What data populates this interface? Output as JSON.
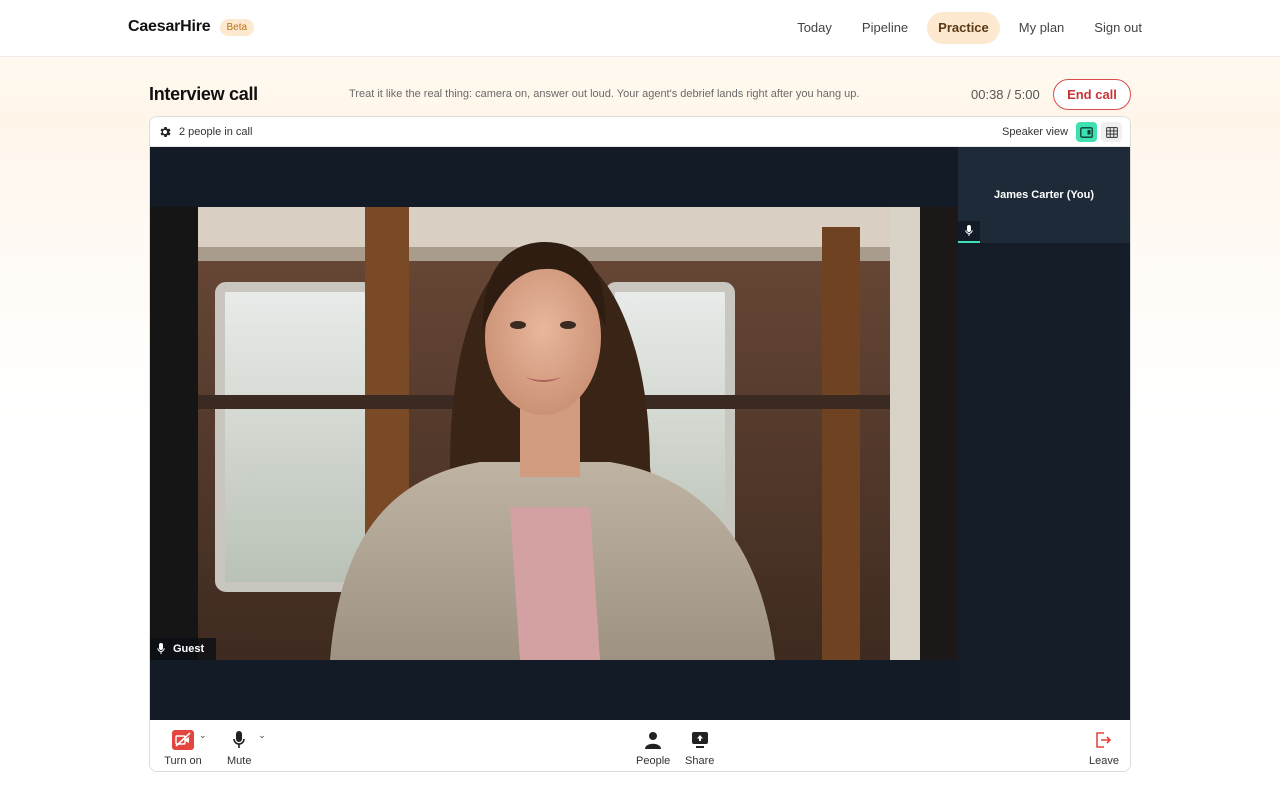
{
  "brand": {
    "name": "CaesarHire",
    "badge": "Beta"
  },
  "nav": {
    "items": [
      {
        "label": "Today",
        "active": false
      },
      {
        "label": "Pipeline",
        "active": false
      },
      {
        "label": "Practice",
        "active": true
      },
      {
        "label": "My plan",
        "active": false
      },
      {
        "label": "Sign out",
        "active": false
      }
    ]
  },
  "page": {
    "title": "Interview call",
    "instructions": "Treat it like the real thing: camera on, answer out loud. Your agent's debrief lands right after you hang up.",
    "timer": "00:38 / 5:00",
    "end_call_label": "End call"
  },
  "call": {
    "people_count": "2 people in call",
    "view_label": "Speaker view",
    "main_participant": {
      "name": "Guest",
      "icon": "mic-icon"
    },
    "self_participant": {
      "name": "James Carter (You)",
      "icon": "mic-icon"
    },
    "accent_color": "#3fe0b2"
  },
  "controls": {
    "camera_label": "Turn on",
    "mute_label": "Mute",
    "people_label": "People",
    "share_label": "Share",
    "leave_label": "Leave"
  },
  "colors": {
    "brand_accent": "#fde9cf",
    "danger": "#d94d4d",
    "stage_bg": "#131b26"
  }
}
